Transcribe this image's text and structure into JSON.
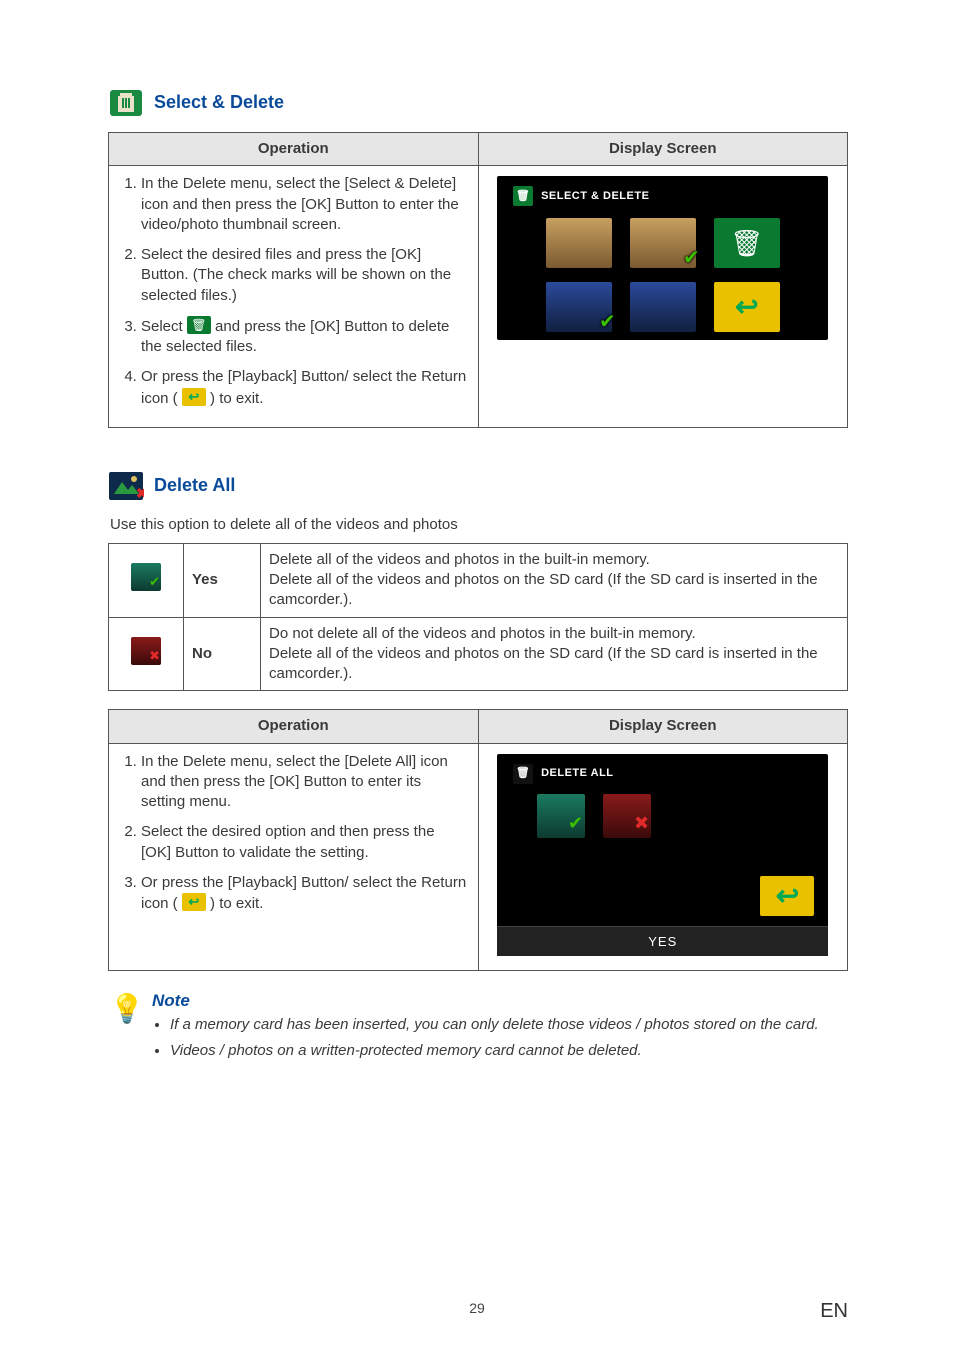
{
  "section1": {
    "title": "Select & Delete",
    "op_header": "Operation",
    "ds_header": "Display Screen",
    "step1": "In the Delete menu, select the [Select & Delete] icon and then press the [OK] Button to enter the video/photo thumbnail screen.",
    "step2": "Select the desired files and press the [OK] Button. (The check marks will be shown on the selected files.)",
    "step3a": "Select ",
    "step3b": " and press the [OK] Button to delete the selected files.",
    "step4a": "Or press the [Playback] Button/ select the Return icon ( ",
    "step4b": " ) to exit.",
    "ds_title": "SELECT & DELETE"
  },
  "section2": {
    "title": "Delete All",
    "caption": "Use this option to delete all of the videos and photos",
    "yes_label": "Yes",
    "yes_txt1": "Delete all of the videos and photos in the built-in memory.",
    "yes_txt2": "Delete all of the videos and photos on the SD card (If the SD card is inserted in the camcorder.).",
    "no_label": "No",
    "no_txt1": "Do not delete all of the videos and photos in the built-in memory.",
    "no_txt2": "Delete all of the videos and photos on the SD card (If the SD card is inserted in the camcorder.).",
    "op_header": "Operation",
    "ds_header": "Display Screen",
    "step1": "In the Delete menu, select the [Delete All] icon and then press the [OK] Button to enter its setting menu.",
    "step2": "Select the desired option and then press the [OK] Button to validate the setting.",
    "step3a": "Or press the [Playback] Button/ select the Return icon ( ",
    "step3b": " ) to exit.",
    "ds_title": "DELETE ALL",
    "ds_yes": "YES"
  },
  "note": {
    "heading": "Note",
    "n1": "If a memory card has been inserted, you can only delete those videos / photos stored on the card.",
    "n2": "Videos / photos on a written-protected memory card cannot be deleted."
  },
  "footer": {
    "page": "29",
    "lang": "EN"
  }
}
